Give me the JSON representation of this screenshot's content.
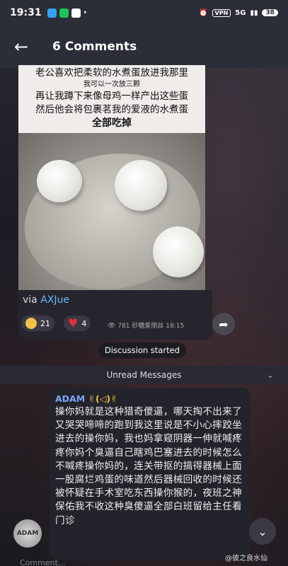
{
  "status_bar": {
    "time": "19:31",
    "vpn": "VPN",
    "network": "5G",
    "battery": "38"
  },
  "header": {
    "title": "6 Comments"
  },
  "post": {
    "caption_lines": [
      "老公喜欢把柔软的水煮蛋放进我那里",
      "我可以一次放三颗",
      "再让我蹲下来像母鸡一样产出这些蛋",
      "然后他会将包裹茗我的爱液的水煮蛋",
      "全部吃掉"
    ],
    "via_label": "via",
    "via_author": "AXJue",
    "reactions": [
      {
        "icon": "cowboy-face-icon",
        "count": "21"
      },
      {
        "icon": "heart-icon",
        "count": "4"
      }
    ],
    "views": "781",
    "poster": "砂糖爱丽丝",
    "time": "18:15"
  },
  "discussion_label": "Discussion started",
  "unread_label": "Unread Messages",
  "message": {
    "author": "ADAM",
    "author_emoji": "✌(◁)✌",
    "text": "操你妈就是这种猎奇傻逼，哪天掏不出来了又哭哭啼啼的跑到我这里说是不小心摔跤坐进去的操你妈，我也妈拿窥阴器一伸就喊疼疼你妈个臭逼自己瞎鸡巴塞进去的时候怎么不喊疼操你妈的，连关带抠的搞得器械上面一股腐烂鸡蛋的味道然后器械回收的时候还被怀疑在手术室吃东西操你猴的，夜班之神保佑我不收这种臭傻逼全部白班留给主任看门诊"
  },
  "avatar_text": "ADAM",
  "watermark": "@彼之良水仙",
  "input_placeholder": "Comment..."
}
